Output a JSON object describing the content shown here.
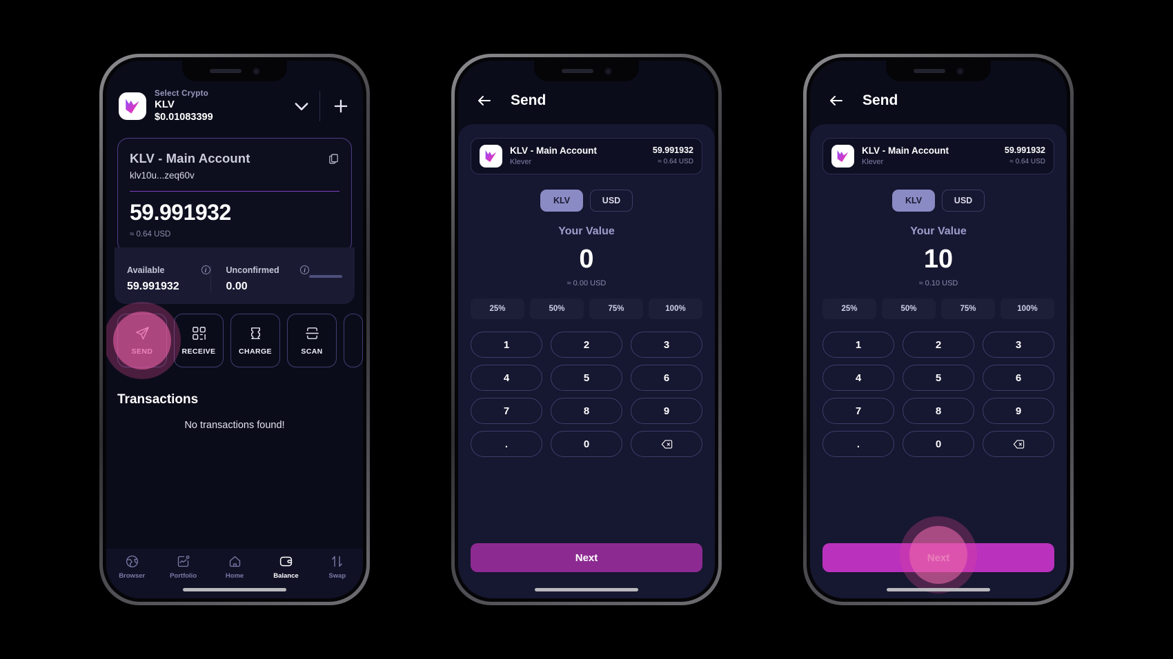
{
  "phone1": {
    "header": {
      "select_label": "Select Crypto",
      "symbol": "KLV",
      "price": "$0.01083399",
      "chevron_icon": "chevron-down-icon",
      "add_icon": "plus-icon",
      "logo_icon": "klever-logo-icon"
    },
    "account_card": {
      "title": "KLV - Main Account",
      "address": "klv10u...zeq60v",
      "balance": "59.991932",
      "usd": "≈ 0.64 USD",
      "copy_icon": "copy-icon"
    },
    "stats": [
      {
        "label": "Available",
        "value": "59.991932",
        "info_icon": "info-icon"
      },
      {
        "label": "Unconfirmed",
        "value": "0.00",
        "info_icon": "info-icon"
      }
    ],
    "actions": [
      {
        "label": "SEND",
        "icon": "send-paper-plane-icon",
        "tapped": true
      },
      {
        "label": "RECEIVE",
        "icon": "qr-code-icon",
        "tapped": false
      },
      {
        "label": "CHARGE",
        "icon": "ticket-icon",
        "tapped": false
      },
      {
        "label": "SCAN",
        "icon": "scan-frame-icon",
        "tapped": false
      }
    ],
    "transactions": {
      "title": "Transactions",
      "empty": "No transactions found!"
    },
    "nav": [
      {
        "label": "Browser",
        "icon": "globe-icon",
        "active": false
      },
      {
        "label": "Portfolio",
        "icon": "chart-icon",
        "active": false
      },
      {
        "label": "Home",
        "icon": "home-icon",
        "active": false
      },
      {
        "label": "Balance",
        "icon": "wallet-icon",
        "active": true
      },
      {
        "label": "Swap",
        "icon": "swap-arrows-icon",
        "active": false
      }
    ]
  },
  "phone2": {
    "header": {
      "title": "Send",
      "back_icon": "arrow-left-icon"
    },
    "account": {
      "name": "KLV - Main Account",
      "sub": "Klever",
      "balance": "59.991932",
      "usd": "≈ 0.64 USD",
      "logo_icon": "klever-logo-icon"
    },
    "toggles": [
      {
        "label": "KLV",
        "active": true
      },
      {
        "label": "USD",
        "active": false
      }
    ],
    "value": {
      "label": "Your Value",
      "amount": "0",
      "usd": "≈ 0.00 USD"
    },
    "percentages": [
      "25%",
      "50%",
      "75%",
      "100%"
    ],
    "keys": [
      "1",
      "2",
      "3",
      "4",
      "5",
      "6",
      "7",
      "8",
      "9",
      ".",
      "0",
      "backspace-icon"
    ],
    "next": {
      "label": "Next",
      "tapped": false
    }
  },
  "phone3": {
    "header": {
      "title": "Send",
      "back_icon": "arrow-left-icon"
    },
    "account": {
      "name": "KLV - Main Account",
      "sub": "Klever",
      "balance": "59.991932",
      "usd": "≈ 0.64 USD",
      "logo_icon": "klever-logo-icon"
    },
    "toggles": [
      {
        "label": "KLV",
        "active": true
      },
      {
        "label": "USD",
        "active": false
      }
    ],
    "value": {
      "label": "Your Value",
      "amount": "10",
      "usd": "≈ 0.10 USD"
    },
    "percentages": [
      "25%",
      "50%",
      "75%",
      "100%"
    ],
    "keys": [
      "1",
      "2",
      "3",
      "4",
      "5",
      "6",
      "7",
      "8",
      "9",
      ".",
      "0",
      "backspace-icon"
    ],
    "next": {
      "label": "Next",
      "tapped": true
    }
  },
  "colors": {
    "background": "#000000",
    "screen": "#0b0c1a",
    "accent_purple": "#7b3fbf",
    "toggle_active": "#8a8ac4",
    "next_button": "#8d2a92",
    "next_button_active": "#ba31bd",
    "tap_highlight": "#e96 0a5"
  }
}
